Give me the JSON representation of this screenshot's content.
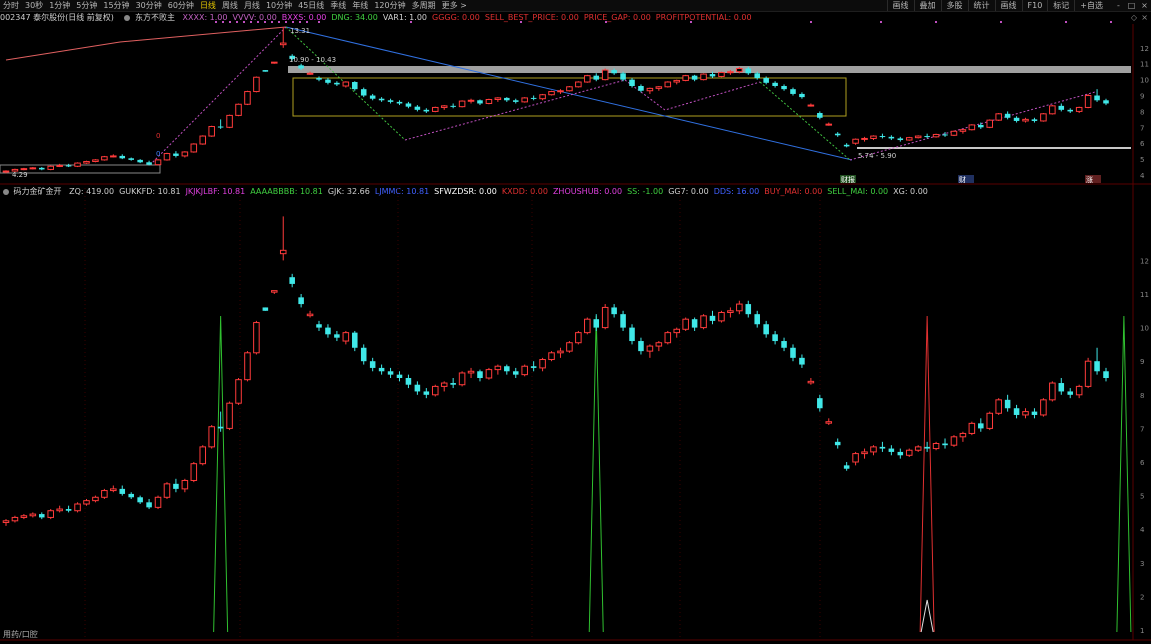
{
  "toolbar": {
    "periods": [
      "分时",
      "30秒",
      "1分钟",
      "5分钟",
      "15分钟",
      "30分钟",
      "60分钟",
      "日线",
      "周线",
      "月线",
      "10分钟",
      "45日线",
      "季线",
      "年线",
      "120分钟",
      "多周期",
      "更多 >"
    ],
    "active_index": 7,
    "right_tools": [
      "画线",
      "叠加",
      "多股",
      "统计",
      "画线",
      "F10",
      "标记",
      "+自选"
    ],
    "window_buttons": [
      "-",
      "□",
      "×"
    ]
  },
  "top_header": {
    "stock": "002347 泰尔股份(日线 前复权)",
    "indicator_name": "东方不败主",
    "items": [
      {
        "text": "XXXX: 1.00",
        "color": "#c060c0"
      },
      {
        "text": "VVVV: 0.00",
        "color": "#c060c0"
      },
      {
        "text": "BXXS: 0.00",
        "color": "#e040e0"
      },
      {
        "text": "DNG: 34.00",
        "color": "#40d040"
      },
      {
        "text": "VAR1: 1.00",
        "color": "#d0d0d0"
      },
      {
        "text": "GGGG: 0.00",
        "color": "#e03030"
      },
      {
        "text": "SELL_BEST_PRICE: 0.00",
        "color": "#e03030"
      },
      {
        "text": "PRICE_GAP: 0.00",
        "color": "#e03030"
      },
      {
        "text": "PROFITPOTENTIAL: 0.00",
        "color": "#e03030"
      }
    ]
  },
  "bottom_header": {
    "indicator_name": "码力金矿金开",
    "items": [
      {
        "text": "ZQ: 419.00",
        "color": "#d0d0d0"
      },
      {
        "text": "GUKKFD: 10.81",
        "color": "#d0d0d0"
      },
      {
        "text": "JKJKJLBF: 10.81",
        "color": "#e040e0"
      },
      {
        "text": "AAAABBBB: 10.81",
        "color": "#40d040"
      },
      {
        "text": "GJK: 32.66",
        "color": "#d0d0d0"
      },
      {
        "text": "LJMMC: 10.81",
        "color": "#4060ff"
      },
      {
        "text": "SFWZDSR: 0.00",
        "color": "#ffffff"
      },
      {
        "text": "KXDD: 0.00",
        "color": "#e03030"
      },
      {
        "text": "ZHOUSHUB: 0.00",
        "color": "#e040e0"
      },
      {
        "text": "SS: -1.00",
        "color": "#40d040"
      },
      {
        "text": "GG7: 0.00",
        "color": "#d0d0d0"
      },
      {
        "text": "DDS: 16.00",
        "color": "#4060ff"
      },
      {
        "text": "BUY_MAI: 0.00",
        "color": "#e03030"
      },
      {
        "text": "SELL_MAI: 0.00",
        "color": "#40d040"
      },
      {
        "text": "XG: 0.00",
        "color": "#d0d0d0"
      }
    ]
  },
  "annotations": {
    "high_label": "13.31",
    "range1": "10.90 - 10.43",
    "range2": "5.74 - 5.90",
    "low_label": "4.29",
    "mark_zero_a": "0",
    "mark_zero_b": "0",
    "badge_left": "财报",
    "badge_mid": "财",
    "badge_right": "涨",
    "bottom_left_label": "用药/口腔"
  },
  "top_axis": [
    "12",
    "11",
    "10",
    "9",
    "8",
    "7",
    "6",
    "5",
    "4"
  ],
  "bottom_axis": [
    "12",
    "11",
    "10",
    "9",
    "8",
    "7",
    "6",
    "5",
    "4",
    "3",
    "2",
    "1"
  ],
  "colors": {
    "up": "#ff3b3b",
    "down": "#40e8e8",
    "grid": "#3a0000"
  },
  "chart_data": {
    "type": "candlestick",
    "ohlc": [
      [
        4.2,
        4.3,
        4.1,
        4.25
      ],
      [
        4.25,
        4.4,
        4.2,
        4.35
      ],
      [
        4.35,
        4.45,
        4.3,
        4.4
      ],
      [
        4.4,
        4.5,
        4.35,
        4.45
      ],
      [
        4.45,
        4.5,
        4.3,
        4.35
      ],
      [
        4.35,
        4.6,
        4.3,
        4.55
      ],
      [
        4.55,
        4.7,
        4.5,
        4.6
      ],
      [
        4.6,
        4.7,
        4.5,
        4.55
      ],
      [
        4.55,
        4.8,
        4.5,
        4.75
      ],
      [
        4.75,
        4.9,
        4.7,
        4.85
      ],
      [
        4.85,
        5.0,
        4.8,
        4.95
      ],
      [
        4.95,
        5.2,
        4.9,
        5.15
      ],
      [
        5.15,
        5.3,
        5.1,
        5.2
      ],
      [
        5.2,
        5.3,
        5.0,
        5.05
      ],
      [
        5.05,
        5.1,
        4.9,
        4.95
      ],
      [
        4.95,
        5.0,
        4.75,
        4.8
      ],
      [
        4.8,
        4.9,
        4.6,
        4.65
      ],
      [
        4.65,
        5.0,
        4.6,
        4.95
      ],
      [
        4.95,
        5.4,
        4.9,
        5.35
      ],
      [
        5.35,
        5.5,
        5.1,
        5.2
      ],
      [
        5.2,
        5.5,
        5.1,
        5.45
      ],
      [
        5.45,
        6.0,
        5.4,
        5.95
      ],
      [
        5.95,
        6.5,
        5.9,
        6.45
      ],
      [
        6.45,
        7.1,
        6.4,
        7.05
      ],
      [
        7.05,
        7.5,
        6.9,
        7.0
      ],
      [
        7.0,
        7.8,
        6.95,
        7.75
      ],
      [
        7.75,
        8.5,
        7.7,
        8.45
      ],
      [
        8.45,
        9.3,
        8.4,
        9.25
      ],
      [
        9.25,
        10.2,
        9.2,
        10.15
      ],
      [
        10.6,
        10.6,
        10.5,
        10.5
      ],
      [
        11.1,
        11.1,
        11.0,
        11.1
      ],
      [
        12.2,
        13.31,
        12.0,
        12.3
      ],
      [
        11.5,
        11.6,
        11.2,
        11.3
      ],
      [
        10.9,
        11.0,
        10.6,
        10.7
      ],
      [
        10.4,
        10.5,
        10.3,
        10.4
      ],
      [
        10.1,
        10.2,
        9.9,
        10.0
      ],
      [
        10.0,
        10.1,
        9.7,
        9.8
      ],
      [
        9.8,
        9.9,
        9.6,
        9.7
      ],
      [
        9.6,
        9.9,
        9.5,
        9.85
      ],
      [
        9.85,
        9.9,
        9.3,
        9.4
      ],
      [
        9.4,
        9.5,
        8.9,
        9.0
      ],
      [
        9.0,
        9.1,
        8.7,
        8.8
      ],
      [
        8.8,
        8.9,
        8.6,
        8.7
      ],
      [
        8.7,
        8.8,
        8.5,
        8.6
      ],
      [
        8.6,
        8.7,
        8.4,
        8.5
      ],
      [
        8.5,
        8.6,
        8.2,
        8.3
      ],
      [
        8.3,
        8.4,
        8.0,
        8.1
      ],
      [
        8.1,
        8.2,
        7.9,
        8.0
      ],
      [
        8.0,
        8.3,
        7.95,
        8.25
      ],
      [
        8.25,
        8.4,
        8.1,
        8.35
      ],
      [
        8.35,
        8.5,
        8.2,
        8.3
      ],
      [
        8.3,
        8.7,
        8.25,
        8.65
      ],
      [
        8.65,
        8.8,
        8.5,
        8.7
      ],
      [
        8.7,
        8.75,
        8.4,
        8.5
      ],
      [
        8.5,
        8.8,
        8.45,
        8.75
      ],
      [
        8.75,
        8.9,
        8.6,
        8.85
      ],
      [
        8.85,
        8.9,
        8.6,
        8.7
      ],
      [
        8.7,
        8.8,
        8.5,
        8.6
      ],
      [
        8.6,
        8.9,
        8.55,
        8.85
      ],
      [
        8.85,
        9.0,
        8.7,
        8.8
      ],
      [
        8.8,
        9.1,
        8.7,
        9.05
      ],
      [
        9.05,
        9.3,
        9.0,
        9.25
      ],
      [
        9.25,
        9.4,
        9.1,
        9.3
      ],
      [
        9.3,
        9.6,
        9.25,
        9.55
      ],
      [
        9.55,
        9.9,
        9.5,
        9.85
      ],
      [
        9.85,
        10.3,
        9.8,
        10.25
      ],
      [
        10.25,
        10.4,
        9.9,
        10.0
      ],
      [
        10.0,
        10.7,
        9.95,
        10.6
      ],
      [
        10.6,
        10.7,
        10.3,
        10.4
      ],
      [
        10.4,
        10.5,
        9.9,
        10.0
      ],
      [
        10.0,
        10.1,
        9.5,
        9.6
      ],
      [
        9.6,
        9.7,
        9.2,
        9.3
      ],
      [
        9.3,
        9.5,
        9.1,
        9.45
      ],
      [
        9.45,
        9.6,
        9.3,
        9.55
      ],
      [
        9.55,
        9.9,
        9.5,
        9.85
      ],
      [
        9.85,
        10.0,
        9.7,
        9.95
      ],
      [
        9.95,
        10.3,
        9.9,
        10.25
      ],
      [
        10.25,
        10.3,
        9.9,
        10.0
      ],
      [
        10.0,
        10.4,
        9.95,
        10.35
      ],
      [
        10.35,
        10.5,
        10.1,
        10.2
      ],
      [
        10.2,
        10.5,
        10.15,
        10.45
      ],
      [
        10.45,
        10.6,
        10.3,
        10.5
      ],
      [
        10.5,
        10.8,
        10.4,
        10.7
      ],
      [
        10.7,
        10.8,
        10.3,
        10.4
      ],
      [
        10.4,
        10.5,
        10.0,
        10.1
      ],
      [
        10.1,
        10.2,
        9.7,
        9.8
      ],
      [
        9.8,
        9.9,
        9.5,
        9.6
      ],
      [
        9.6,
        9.7,
        9.3,
        9.4
      ],
      [
        9.4,
        9.5,
        9.0,
        9.1
      ],
      [
        9.1,
        9.2,
        8.8,
        8.9
      ],
      [
        8.4,
        8.5,
        8.3,
        8.4
      ],
      [
        7.9,
        8.0,
        7.5,
        7.6
      ],
      [
        7.2,
        7.3,
        7.1,
        7.2
      ],
      [
        6.6,
        6.7,
        6.4,
        6.5
      ],
      [
        5.9,
        6.0,
        5.74,
        5.8
      ],
      [
        6.0,
        6.3,
        5.9,
        6.25
      ],
      [
        6.25,
        6.4,
        6.1,
        6.3
      ],
      [
        6.3,
        6.5,
        6.2,
        6.45
      ],
      [
        6.45,
        6.6,
        6.3,
        6.4
      ],
      [
        6.4,
        6.5,
        6.2,
        6.3
      ],
      [
        6.3,
        6.4,
        6.1,
        6.2
      ],
      [
        6.2,
        6.4,
        6.15,
        6.35
      ],
      [
        6.35,
        6.5,
        6.3,
        6.45
      ],
      [
        6.45,
        6.6,
        6.3,
        6.4
      ],
      [
        6.4,
        6.6,
        6.35,
        6.55
      ],
      [
        6.55,
        6.7,
        6.4,
        6.5
      ],
      [
        6.5,
        6.8,
        6.45,
        6.75
      ],
      [
        6.75,
        6.9,
        6.6,
        6.85
      ],
      [
        6.85,
        7.2,
        6.8,
        7.15
      ],
      [
        7.15,
        7.3,
        6.9,
        7.0
      ],
      [
        7.0,
        7.5,
        6.95,
        7.45
      ],
      [
        7.45,
        7.9,
        7.4,
        7.85
      ],
      [
        7.85,
        8.0,
        7.5,
        7.6
      ],
      [
        7.6,
        7.7,
        7.3,
        7.4
      ],
      [
        7.4,
        7.6,
        7.3,
        7.5
      ],
      [
        7.5,
        7.6,
        7.3,
        7.4
      ],
      [
        7.4,
        7.9,
        7.35,
        7.85
      ],
      [
        7.85,
        8.4,
        7.8,
        8.35
      ],
      [
        8.35,
        8.5,
        8.0,
        8.1
      ],
      [
        8.1,
        8.2,
        7.9,
        8.0
      ],
      [
        8.0,
        8.3,
        7.9,
        8.25
      ],
      [
        8.25,
        9.1,
        8.2,
        9.0
      ],
      [
        9.0,
        9.4,
        8.6,
        8.7
      ],
      [
        8.7,
        8.8,
        8.4,
        8.5
      ]
    ],
    "bottom_spikes": [
      {
        "index": 24,
        "color": "green"
      },
      {
        "index": 66,
        "color": "green"
      },
      {
        "index": 103,
        "color": "red"
      },
      {
        "index": 125,
        "color": "green"
      },
      {
        "index": 133,
        "color": "green"
      }
    ]
  }
}
